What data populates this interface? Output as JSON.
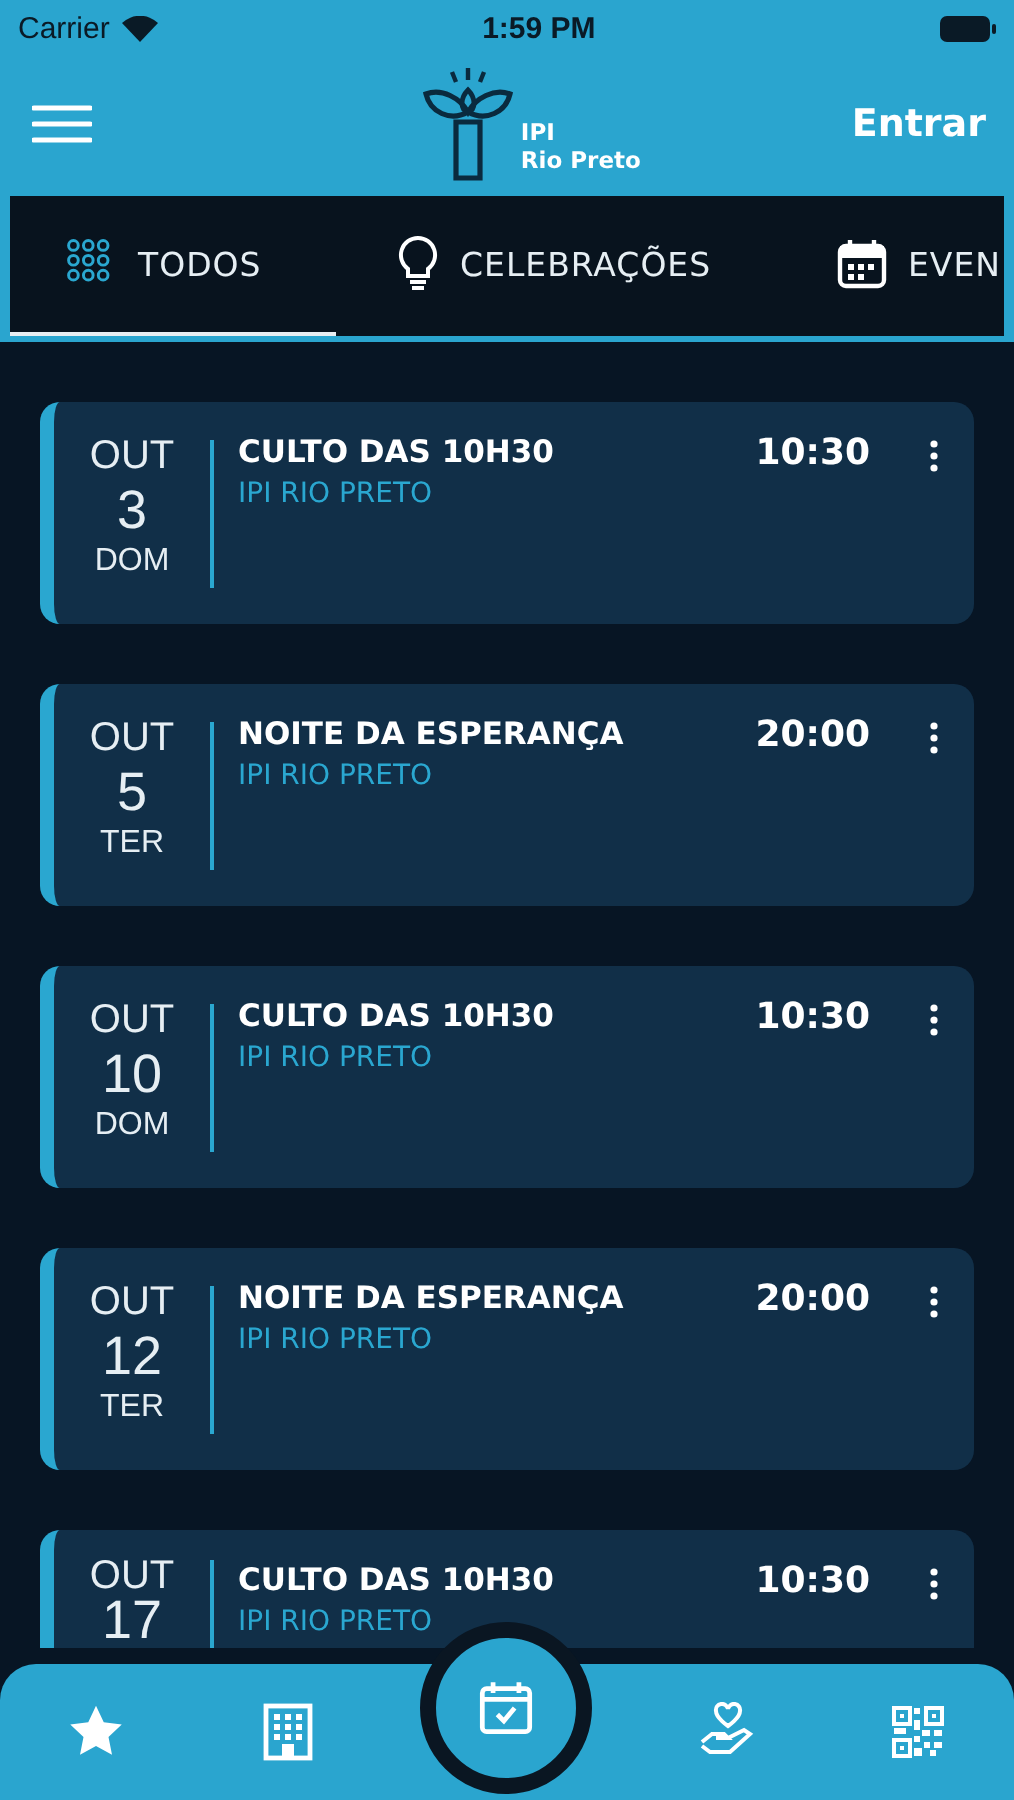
{
  "status_bar": {
    "carrier": "Carrier",
    "time": "1:59 PM"
  },
  "header": {
    "logo_line_1": "IPI",
    "logo_line_2": "Rio Preto",
    "login": "Entrar"
  },
  "tabs": [
    {
      "label": "TODOS",
      "selected": true,
      "kind": "grid"
    },
    {
      "label": "CELEBRAÇÕES",
      "selected": false,
      "kind": "bulb"
    },
    {
      "label": "EVEN",
      "selected": false,
      "kind": "calendar"
    }
  ],
  "events": [
    {
      "month": "OUT",
      "day": "3",
      "weekday": "DOM",
      "title": "CULTO DAS 10H30",
      "place": "IPI RIO PRETO",
      "time": "10:30"
    },
    {
      "month": "OUT",
      "day": "5",
      "weekday": "TER",
      "title": "NOITE DA ESPERANÇA",
      "place": "IPI RIO PRETO",
      "time": "20:00"
    },
    {
      "month": "OUT",
      "day": "10",
      "weekday": "DOM",
      "title": "CULTO DAS 10H30",
      "place": "IPI RIO PRETO",
      "time": "10:30"
    },
    {
      "month": "OUT",
      "day": "12",
      "weekday": "TER",
      "title": "NOITE DA ESPERANÇA",
      "place": "IPI RIO PRETO",
      "time": "20:00"
    },
    {
      "month": "OUT",
      "day": "17",
      "title": "CULTO DAS 10H30",
      "place": "IPI RIO PRETO",
      "time": "10:30"
    }
  ],
  "bottom_nav": [
    {
      "kind": "star",
      "selected": false
    },
    {
      "kind": "building",
      "selected": false
    },
    {
      "kind": "calendar",
      "selected": true
    },
    {
      "kind": "charity",
      "selected": false
    },
    {
      "kind": "qr",
      "selected": false
    }
  ]
}
